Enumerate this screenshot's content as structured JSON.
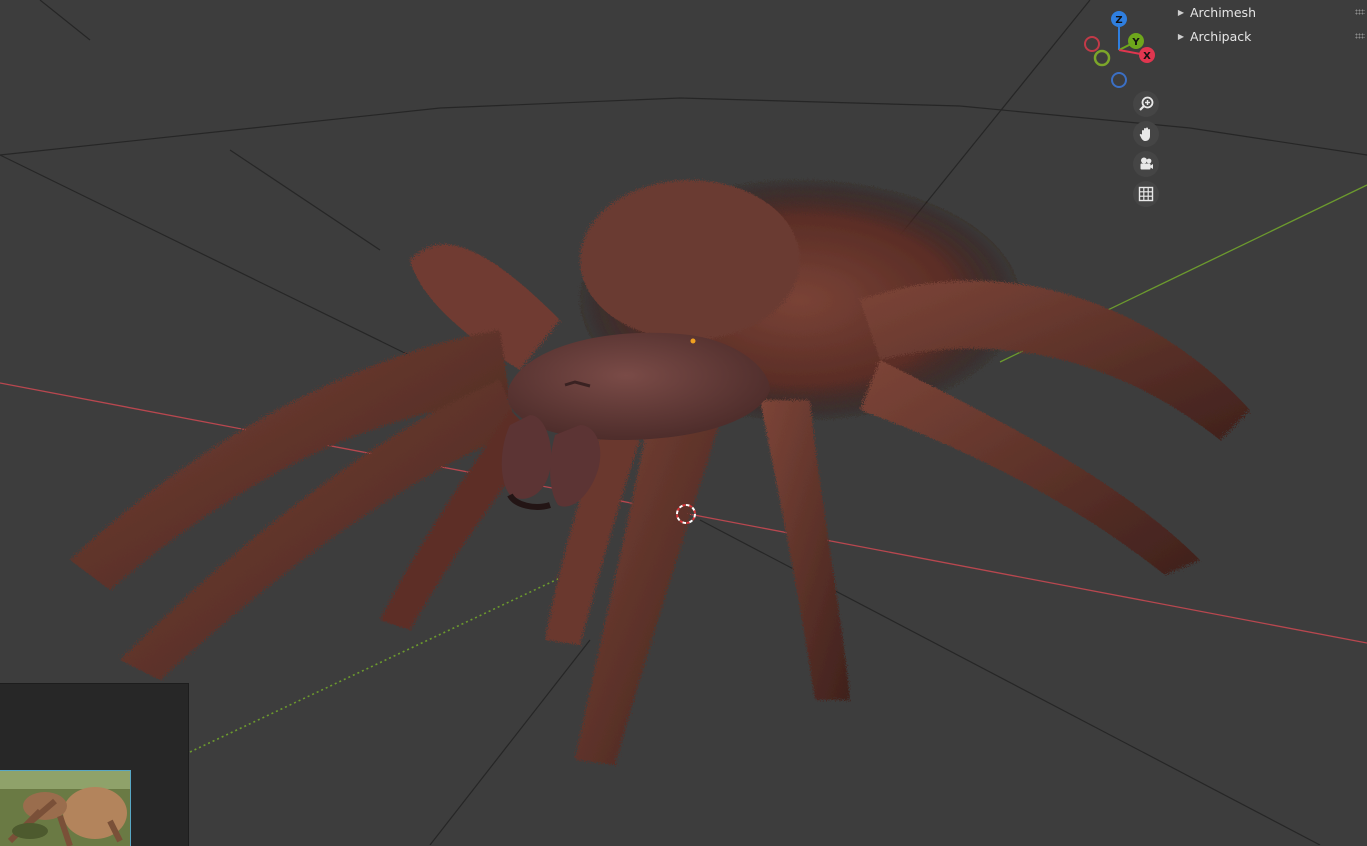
{
  "addons": [
    {
      "label": "Archimesh"
    },
    {
      "label": "Archipack"
    }
  ],
  "gizmo": {
    "axes": [
      {
        "label": "Z",
        "color": "#2f7fe0"
      },
      {
        "label": "Y",
        "color": "#6ea71c"
      },
      {
        "label": "X",
        "color": "#e0364f"
      }
    ]
  },
  "nav_controls": [
    {
      "icon": "zoom-icon"
    },
    {
      "icon": "hand-pan-icon"
    },
    {
      "icon": "camera-icon"
    },
    {
      "icon": "grid-icon"
    }
  ],
  "colors": {
    "viewport_bg": "#3d3d3d",
    "x_axis": "#b8474f",
    "y_axis": "#6c9a2e",
    "panel_bg": "#272727",
    "fur": "#6e3a30",
    "carapace": "#6b4040"
  }
}
